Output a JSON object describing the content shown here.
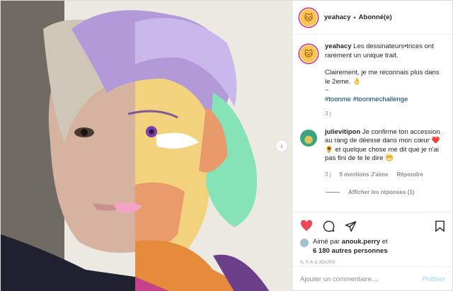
{
  "post": {
    "username": "yeahacy",
    "separator": "•",
    "follow_status": "Abonné(e)",
    "avatar_emoji": "🐱"
  },
  "caption": {
    "username": "yeahacy",
    "line1": "Les dessinateurs•trices ont rarement un unique trait.",
    "line2": "Clairement, je me reconnais plus dans le 2eme. 👌",
    "line3": "~",
    "tag1": "#toonme",
    "tag2": "#toonmechallenge",
    "time": "3 j"
  },
  "comment": {
    "username": "julievitipon",
    "text": "Je confirme ton accession au rang de déesse dans mon cœur ❤️ 🌻 et quelque chose me dit que je n'ai pas fini de te le dire 😁",
    "time": "3 j",
    "likes": "5 mentions J'aime",
    "reply": "Répondre",
    "view_replies": "Afficher les réponses (1)"
  },
  "likes": {
    "prefix": "Aimé par",
    "user": "anouk.perry",
    "conj": "et",
    "others": "6 180 autres personnes"
  },
  "date": "IL Y A 3 JOURS",
  "add_comment": {
    "placeholder": "Ajouter un commentaire...",
    "post_label": "Publier"
  },
  "icons": {
    "like": "heart-filled-icon",
    "comment": "comment-icon",
    "share": "share-icon",
    "save": "bookmark-icon",
    "next": "chevron-right-icon"
  },
  "colors": {
    "like_red": "#ed4956",
    "tag_blue": "#00376b",
    "post_disabled": "#b2dffc",
    "story_ring": "#d62976"
  }
}
